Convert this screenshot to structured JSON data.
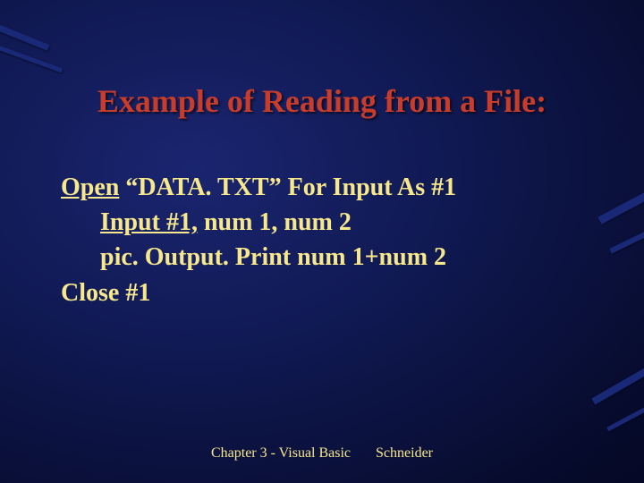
{
  "title": "Example of Reading from a File:",
  "code": {
    "line1_u": "Open",
    "line1_rest": " “DATA. TXT” For Input As #1",
    "line2_u": "Input #1,",
    "line2_rest": " num 1, num 2",
    "line3": "pic. Output. Print num 1+num 2",
    "line4": "Close #1"
  },
  "footer": {
    "left": "Chapter 3 - Visual Basic",
    "right": "Schneider"
  }
}
